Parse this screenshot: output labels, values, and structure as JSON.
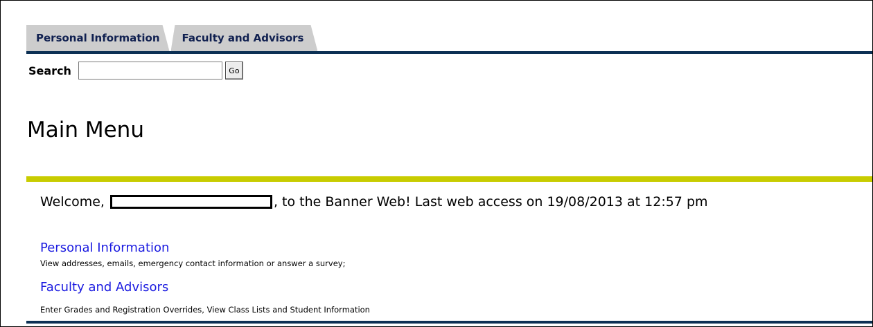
{
  "tabs": [
    {
      "label": "Personal Information"
    },
    {
      "label": "Faculty and Advisors"
    }
  ],
  "search": {
    "label": "Search",
    "value": "",
    "go_label": "Go"
  },
  "page_title": "Main Menu",
  "welcome": {
    "prefix": "Welcome,",
    "suffix": ", to the Banner Web! Last web access on 19/08/2013 at 12:57 pm"
  },
  "menu_items": [
    {
      "label": "Personal Information",
      "description": "View addresses, emails, emergency contact information or answer a survey;"
    },
    {
      "label": "Faculty and Advisors",
      "description": "Enter Grades and Registration Overrides, View Class Lists and Student Information"
    }
  ],
  "colors": {
    "navy_rule": "#0c3054",
    "accent_rule": "#c8cc00",
    "link": "#1a1ae0",
    "tab_bg": "#cdcdcd"
  }
}
